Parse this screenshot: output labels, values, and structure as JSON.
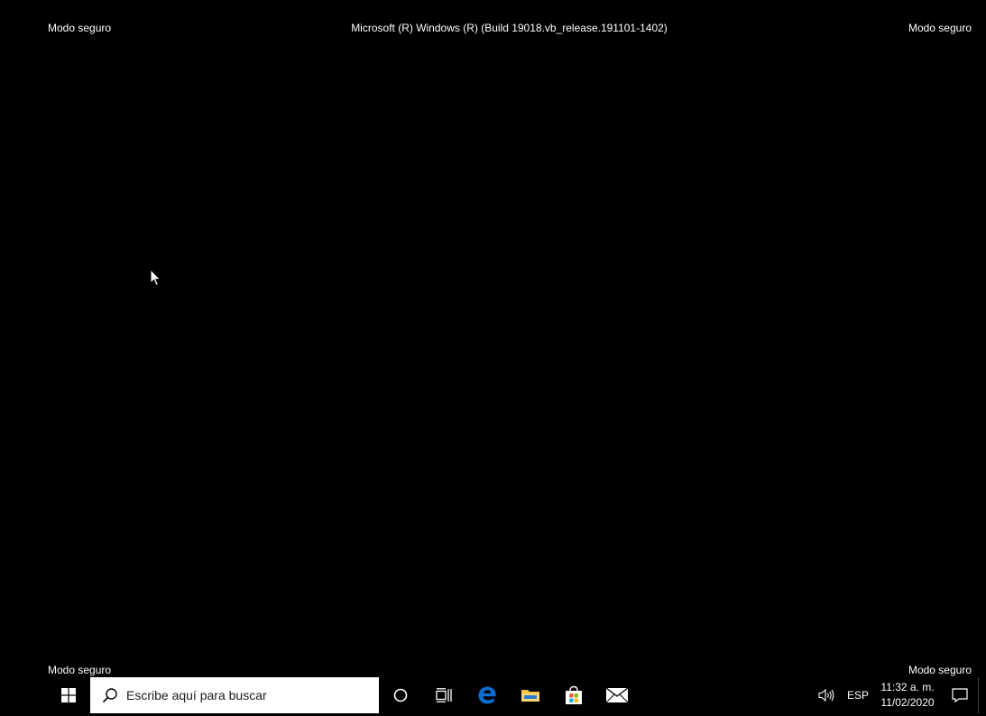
{
  "watermark": {
    "top_left": "Modo seguro",
    "top_right": "Modo seguro",
    "bottom_left": "Modo seguro",
    "bottom_right": "Modo seguro",
    "build_string": "Microsoft (R) Windows (R) (Build 19018.vb_release.191101-1402)"
  },
  "taskbar": {
    "start_icon": "windows-logo-icon",
    "search": {
      "placeholder": "Escribe aquí para buscar",
      "value": "",
      "icon": "search-icon"
    },
    "buttons": [
      {
        "name": "cortana",
        "icon": "cortana-circle-icon"
      },
      {
        "name": "task-view",
        "icon": "task-view-icon"
      },
      {
        "name": "edge",
        "icon": "edge-icon"
      },
      {
        "name": "file-explorer",
        "icon": "folder-icon"
      },
      {
        "name": "store",
        "icon": "store-bag-icon"
      },
      {
        "name": "mail",
        "icon": "mail-icon"
      }
    ],
    "tray": {
      "volume_icon": "speaker-icon",
      "language": "ESP",
      "time": "11:32 a. m.",
      "date": "11/02/2020",
      "notification_icon": "action-center-icon"
    }
  },
  "colors": {
    "background": "#000000",
    "taskbar": "#000000",
    "search_bg": "#ffffff",
    "edge_blue": "#0a6ed1",
    "folder_yellow": "#f5c443"
  }
}
